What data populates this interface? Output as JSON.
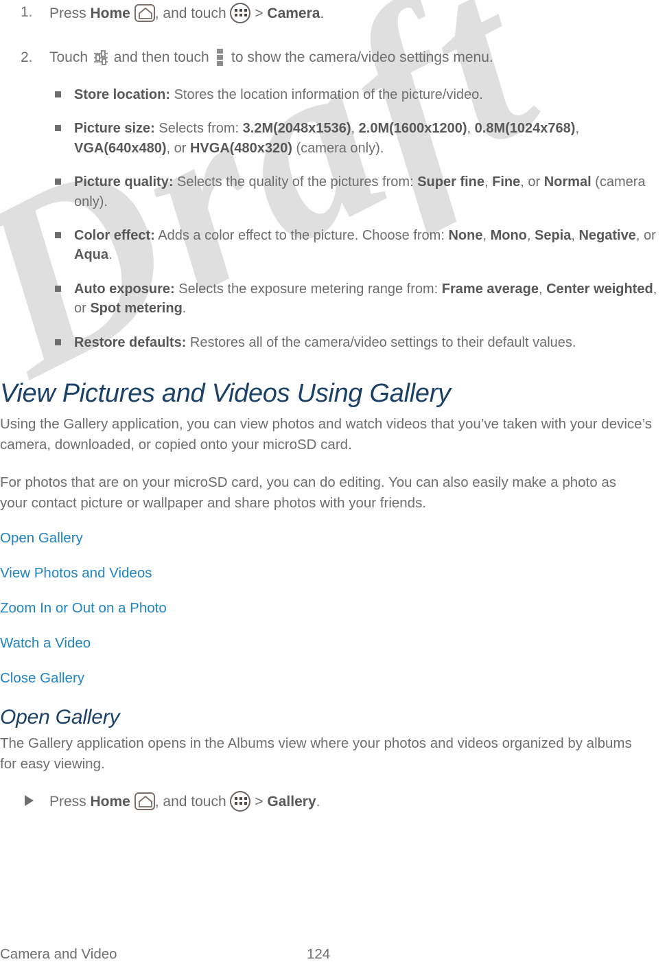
{
  "document": {
    "watermark_text": "Draft",
    "colors": {
      "heading": "#1b4168",
      "link": "#1f84c0",
      "body_text": "#6e6e6e",
      "bold_text": "#585858",
      "watermark": "#dedede"
    }
  },
  "steps": [
    {
      "number": "1.",
      "parts": [
        {
          "t": "Press ",
          "b": false
        },
        {
          "t": "Home",
          "b": true
        },
        {
          "icon": "home-icon"
        },
        {
          "t": ", and touch ",
          "b": false
        },
        {
          "icon": "apps-icon"
        },
        {
          "t": " > ",
          "b": false
        },
        {
          "t": "Camera",
          "b": true
        },
        {
          "t": ".",
          "b": false
        }
      ]
    },
    {
      "number": "2.",
      "parts": [
        {
          "t": "Touch ",
          "b": false
        },
        {
          "icon": "camera-settings-icon"
        },
        {
          "t": " and then touch ",
          "b": false
        },
        {
          "icon": "overflow-menu-icon"
        },
        {
          "t": " to show the camera/video settings menu.",
          "b": false
        }
      ]
    }
  ],
  "settings_bullets": [
    {
      "label": "Store location:",
      "parts": [
        {
          "t": " Stores the location information of the picture/video.",
          "b": false
        }
      ]
    },
    {
      "label": "Picture size:",
      "parts": [
        {
          "t": " Selects from: ",
          "b": false
        },
        {
          "t": "3.2M(2048x1536)",
          "b": true
        },
        {
          "t": ", ",
          "b": false
        },
        {
          "t": "2.0M(1600x1200)",
          "b": true
        },
        {
          "t": ", ",
          "b": false
        },
        {
          "t": "0.8M(1024x768)",
          "b": true
        },
        {
          "t": ", ",
          "b": false
        },
        {
          "t": "VGA(640x480)",
          "b": true
        },
        {
          "t": ", or ",
          "b": false
        },
        {
          "t": "HVGA(480x320)",
          "b": true
        },
        {
          "t": " (camera only).",
          "b": false
        }
      ]
    },
    {
      "label": "Picture quality:",
      "parts": [
        {
          "t": " Selects the quality of the pictures from: ",
          "b": false
        },
        {
          "t": "Super fine",
          "b": true
        },
        {
          "t": ", ",
          "b": false
        },
        {
          "t": "Fine",
          "b": true
        },
        {
          "t": ", or ",
          "b": false
        },
        {
          "t": "Normal",
          "b": true
        },
        {
          "t": " (camera only).",
          "b": false
        }
      ]
    },
    {
      "label": "Color effect:",
      "parts": [
        {
          "t": " Adds a color effect to the picture. Choose from: ",
          "b": false
        },
        {
          "t": "None",
          "b": true
        },
        {
          "t": ", ",
          "b": false
        },
        {
          "t": "Mono",
          "b": true
        },
        {
          "t": ", ",
          "b": false
        },
        {
          "t": "Sepia",
          "b": true
        },
        {
          "t": ", ",
          "b": false
        },
        {
          "t": "Negative",
          "b": true
        },
        {
          "t": ", or ",
          "b": false
        },
        {
          "t": "Aqua",
          "b": true
        },
        {
          "t": ".",
          "b": false
        }
      ]
    },
    {
      "label": "Auto exposure:",
      "parts": [
        {
          "t": " Selects the exposure metering range from: ",
          "b": false
        },
        {
          "t": "Frame average",
          "b": true
        },
        {
          "t": ", ",
          "b": false
        },
        {
          "t": "Center weighted",
          "b": true
        },
        {
          "t": ", or ",
          "b": false
        },
        {
          "t": "Spot metering",
          "b": true
        },
        {
          "t": ".",
          "b": false
        }
      ]
    },
    {
      "label": "Restore defaults:",
      "parts": [
        {
          "t": " Restores all of the camera/video settings to their default values.",
          "b": false
        }
      ]
    }
  ],
  "section": {
    "heading": "View Pictures and Videos Using Gallery",
    "paragraph_1": "Using the Gallery application, you can view photos and watch videos that you’ve taken with your device’s camera, downloaded, or copied onto your microSD card.",
    "paragraph_2": "For photos that are on your microSD card, you can do editing. You can also easily make a photo as your contact picture or wallpaper and share photos with your friends.",
    "links": [
      "Open Gallery",
      "View Photos and Videos",
      "Zoom In or Out on a Photo",
      "Watch a Video",
      "Close Gallery"
    ]
  },
  "subsection": {
    "heading": "Open Gallery",
    "paragraph": "The Gallery application opens in the Albums view where your photos and videos organized by albums for easy viewing.",
    "instruction": {
      "marker": "►",
      "parts": [
        {
          "t": "Press ",
          "b": false
        },
        {
          "t": "Home",
          "b": true
        },
        {
          "icon": "home-icon"
        },
        {
          "t": ", and touch ",
          "b": false
        },
        {
          "icon": "apps-icon"
        },
        {
          "t": " > ",
          "b": false
        },
        {
          "t": "Gallery",
          "b": true
        },
        {
          "t": ".",
          "b": false
        }
      ]
    }
  },
  "footer": {
    "chapter": "Camera and Video",
    "page_number": "124"
  }
}
